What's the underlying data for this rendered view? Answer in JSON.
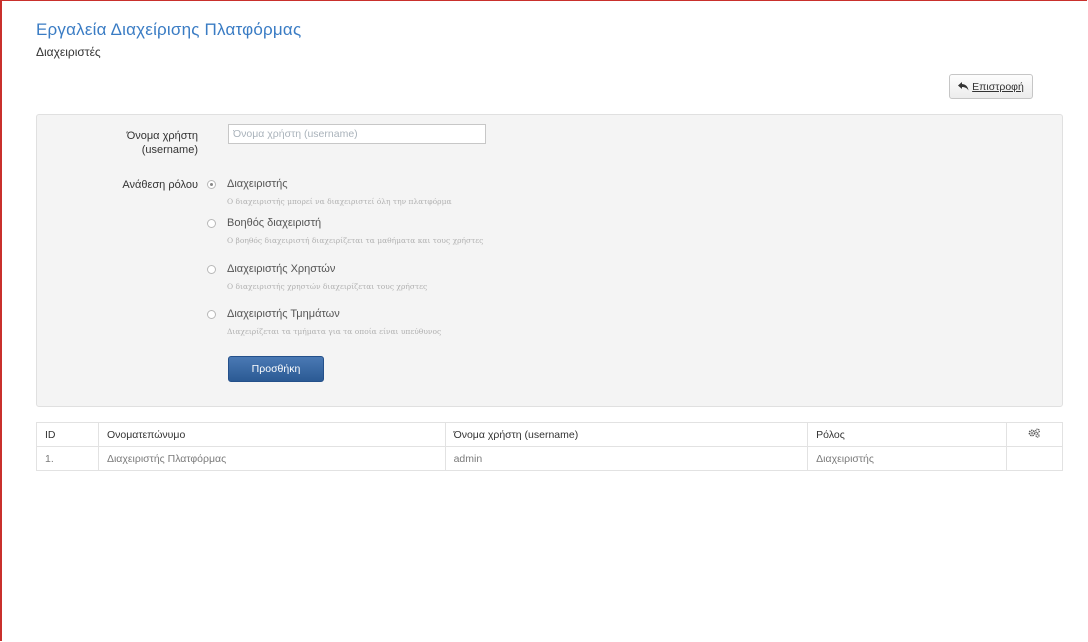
{
  "header": {
    "title": "Εργαλεία Διαχείρισης Πλατφόρμας",
    "subtitle": "Διαχειριστές",
    "back_label": "Επιστροφή"
  },
  "form": {
    "username_label": "Όνομα χρήστη (username)",
    "username_placeholder": "Όνομα χρήστη (username)",
    "username_value": "",
    "role_label": "Ανάθεση ρόλου",
    "roles": [
      {
        "name": "Διαχειριστής",
        "description": "Ο διαχειριστής μπορεί να διαχειριστεί όλη την πλατφόρμα",
        "selected": true
      },
      {
        "name": "Βοηθός διαχειριστή",
        "description": "Ο βοηθός διαχειριστή διαχειρίζεται τα μαθήματα και τους χρήστες",
        "selected": false
      },
      {
        "name": "Διαχειριστής Χρηστών",
        "description": "Ο διαχειριστής χρηστών διαχειρίζεται τους χρήστες",
        "selected": false
      },
      {
        "name": "Διαχειριστής Τμημάτων",
        "description": "Διαχειρίζεται τα τμήματα για τα οποία είναι υπεύθυνος",
        "selected": false
      }
    ],
    "submit_label": "Προσθήκη"
  },
  "table": {
    "headers": {
      "id": "ID",
      "fullname": "Ονοματεπώνυμο",
      "username": "Όνομα χρήστη (username)",
      "role": "Ρόλος",
      "actions_icon": "gears-icon"
    },
    "rows": [
      {
        "id": "1.",
        "fullname": "Διαχειριστής Πλατφόρμας",
        "username": "admin",
        "role": "Διαχειριστής"
      }
    ]
  },
  "colors": {
    "title": "#3a7cc4",
    "primary_button": "#2b5a94",
    "frame_border": "#c9302c"
  }
}
